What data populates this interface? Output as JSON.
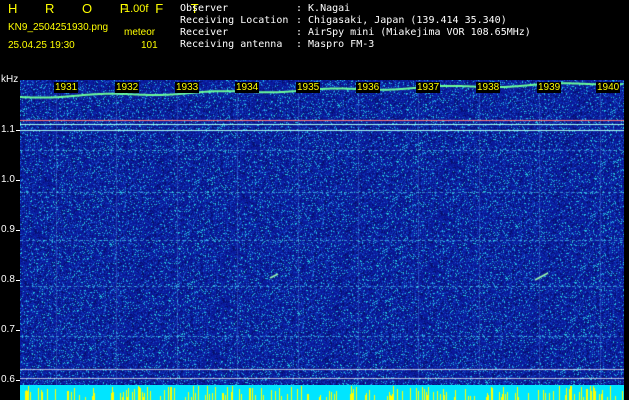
{
  "header": {
    "brand": "H R O F F T",
    "version": "1.00f",
    "filename": "KN9_2504251930.png",
    "mode": "meteor",
    "datetime": "25.04.25 19:30",
    "count": "101"
  },
  "info": [
    {
      "key": "Observer",
      "value": ": K.Nagai"
    },
    {
      "key": "Receiving Location",
      "value": ": Chigasaki, Japan (139.414 35.340)"
    },
    {
      "key": "Receiver",
      "value": ": AirSpy mini (Miakejima VOR 108.65MHz)"
    },
    {
      "key": "Receiving antenna",
      "value": ": Maspro FM-3"
    }
  ],
  "axis": {
    "unit": "kHz",
    "ticks": [
      "1.1",
      "1.0",
      "0.9",
      "0.8",
      "0.7",
      "0.6"
    ]
  },
  "hours": [
    "1931",
    "1932",
    "1933",
    "1934",
    "1935",
    "1936",
    "1937",
    "1938",
    "1939",
    "1940"
  ],
  "colors": {
    "background": "#000000",
    "plot_bg": "#0a1a9c",
    "label": "#ffff00",
    "text": "#ffffff",
    "bottom_bar": "#00e5ff"
  }
}
